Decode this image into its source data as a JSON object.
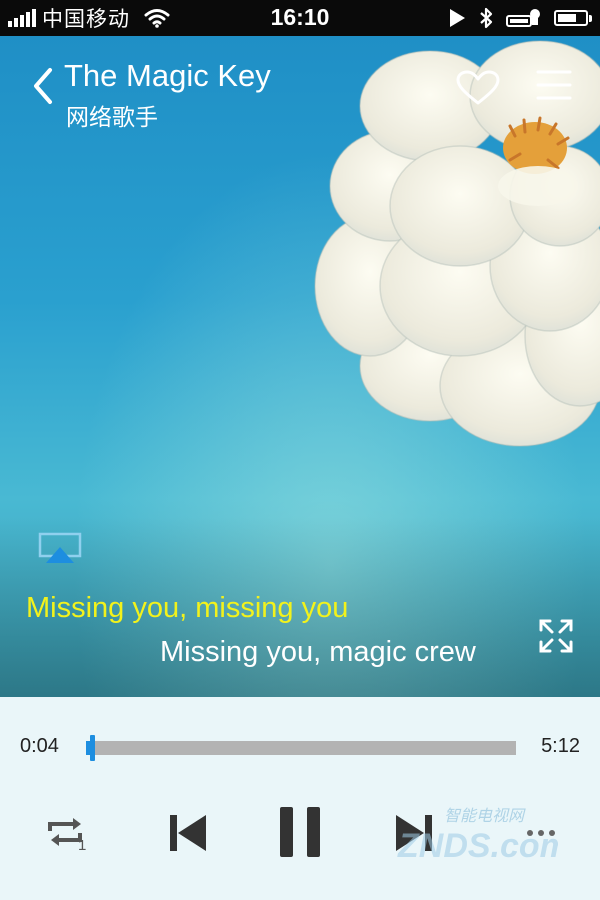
{
  "status_bar": {
    "carrier": "中国移动",
    "time": "16:10",
    "signal_bars": 5,
    "icons": [
      "signal-icon",
      "wifi-icon",
      "location-arrow-icon",
      "bluetooth-icon",
      "alarm-icon",
      "battery-icon"
    ],
    "battery_level": 0.7
  },
  "header": {
    "title": "The Magic Key",
    "artist": "网络歌手",
    "icons": [
      "back-chevron-icon",
      "heart-icon",
      "menu-icon"
    ]
  },
  "artwork": {
    "subject": "white flower on blue background",
    "colors": {
      "sky": "#1f8fc6",
      "sky_light": "#49b9d3",
      "petal": "#f6f5ea",
      "stamen": "#e4a03a"
    }
  },
  "lyrics": {
    "current": "Missing you, missing you",
    "next": "Missing you, magic crew",
    "current_color": "#f2f21c",
    "next_color": "#ffffff"
  },
  "extra_icons": [
    "airplay-icon",
    "fullscreen-icon"
  ],
  "player": {
    "elapsed": "0:04",
    "total": "5:12",
    "progress": 0.013,
    "accent": "#1d8ee0",
    "repeat_badge": "1",
    "controls": [
      "repeat-one-icon",
      "previous-track-icon",
      "pause-icon",
      "next-track-icon",
      "more-icon"
    ]
  },
  "watermark": {
    "text": "ZNDS.com",
    "subtitle": "智能电视网"
  }
}
